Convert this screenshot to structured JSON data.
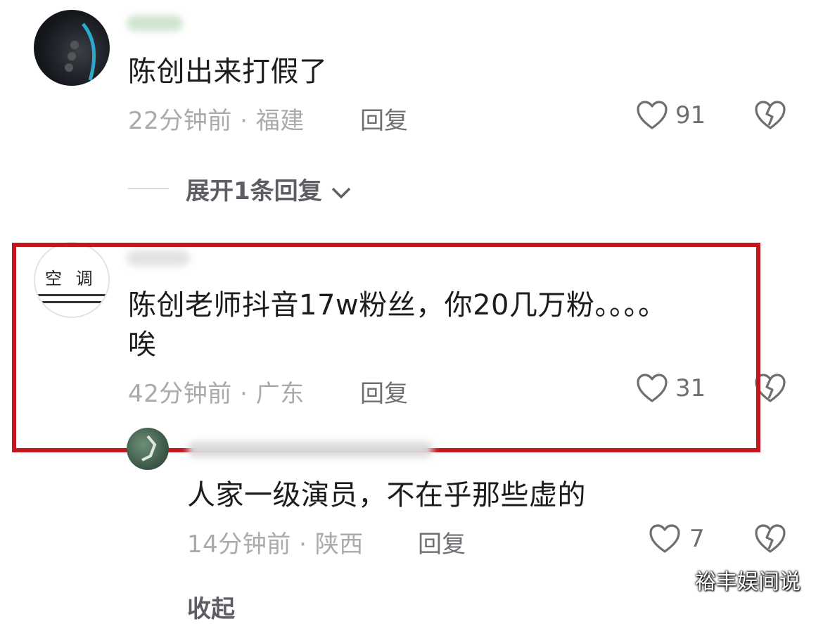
{
  "comments": [
    {
      "text": "陈创出来打假了",
      "time": "22分钟前",
      "location": "福建",
      "reply_label": "回复",
      "likes": "91",
      "expand_label": "展开1条回复"
    },
    {
      "text_line1": "陈创老师抖音17w粉丝，你20几万粉。。。。",
      "text_line2": "唉",
      "avatar_text": "空 调",
      "time": "42分钟前",
      "location": "广东",
      "reply_label": "回复",
      "likes": "31"
    }
  ],
  "reply": {
    "text": "人家一级演员，不在乎那些虚的",
    "time": "14分钟前",
    "location": "陕西",
    "reply_label": "回复",
    "likes": "7"
  },
  "meta_separator": "·",
  "collapse_label": "收起",
  "watermark": "裕丰娱间说",
  "highlight_color": "#c4161c"
}
